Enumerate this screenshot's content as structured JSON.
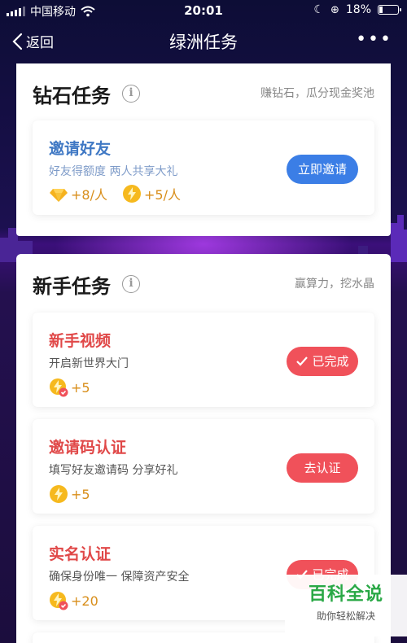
{
  "status_bar": {
    "carrier": "中国移动",
    "time": "20:01",
    "battery_text": "18%",
    "battery_level": 0.18
  },
  "nav": {
    "back_label": "返回",
    "title": "绿洲任务",
    "more_label": "•••"
  },
  "diamond_section": {
    "title": "钻石任务",
    "subtitle": "赚钻石，瓜分现金奖池",
    "tasks": [
      {
        "name": "邀请好友",
        "desc": "好友得额度  两人共享大礼",
        "rewards": [
          "+8/人",
          "+5/人"
        ],
        "button": "立即邀请"
      }
    ]
  },
  "newbie_section": {
    "title": "新手任务",
    "subtitle": "赢算力，挖水晶",
    "tasks": [
      {
        "name": "新手视频",
        "desc": "开启新世界大门",
        "reward": "+5",
        "button": "已完成"
      },
      {
        "name": "邀请码认证",
        "desc": "填写好友邀请码  分享好礼",
        "reward": "+5",
        "button": "去认证"
      },
      {
        "name": "实名认证",
        "desc": "确保身份唯一  保障资产安全",
        "reward": "+20",
        "button": "已完成"
      }
    ]
  },
  "watermark": {
    "title": "百科全说",
    "subtitle": "助你轻松解决"
  },
  "colors": {
    "accent_blue": "#3b7ee6",
    "accent_red": "#f0515a",
    "diamond_task_title": "#3f78c4",
    "newbie_task_title": "#e04848",
    "reward_text": "#d88e1a"
  }
}
